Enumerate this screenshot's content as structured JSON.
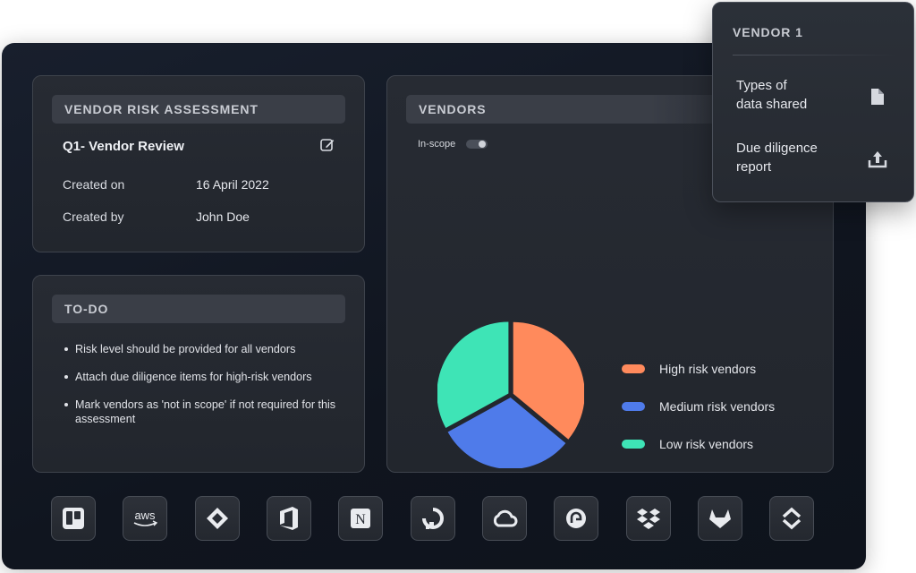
{
  "assessment": {
    "header": "VENDOR RISK ASSESSMENT",
    "review_title": "Q1- Vendor Review",
    "edit_icon": "edit-icon",
    "created_on_label": "Created on",
    "created_on_value": "16 April 2022",
    "created_by_label": "Created by",
    "created_by_value": "John Doe"
  },
  "todo": {
    "header": "TO-DO",
    "items": [
      "Risk level should be provided for all vendors",
      "Attach due diligence items for high-risk vendors",
      "Mark vendors as 'not in scope' if not required for this assessment"
    ]
  },
  "vendors": {
    "header": "VENDORS",
    "in_scope_label": "In-scope",
    "in_scope_on": true
  },
  "chart_data": {
    "type": "pie",
    "labels": [
      "High risk vendors",
      "Medium risk vendors",
      "Low risk vendors"
    ],
    "values": [
      36,
      31,
      33
    ],
    "colors": [
      "#ff8a5c",
      "#4f7bea",
      "#3ee4b6"
    ],
    "legend_position": "right"
  },
  "tools": [
    {
      "name": "trello-icon"
    },
    {
      "name": "aws-icon",
      "text": "aws"
    },
    {
      "name": "diamond-logo-icon"
    },
    {
      "name": "office-icon"
    },
    {
      "name": "notion-icon",
      "text": "N"
    },
    {
      "name": "digitalocean-icon"
    },
    {
      "name": "google-cloud-icon"
    },
    {
      "name": "shield-logo-icon"
    },
    {
      "name": "dropbox-icon"
    },
    {
      "name": "gitlab-icon"
    },
    {
      "name": "chevrons-logo-icon"
    }
  ],
  "popover": {
    "title": "VENDOR 1",
    "rows": [
      {
        "line1": "Types of",
        "line2": "data shared",
        "icon": "document-icon"
      },
      {
        "line1": "Due diligence",
        "line2": "report",
        "icon": "upload-icon"
      }
    ]
  }
}
